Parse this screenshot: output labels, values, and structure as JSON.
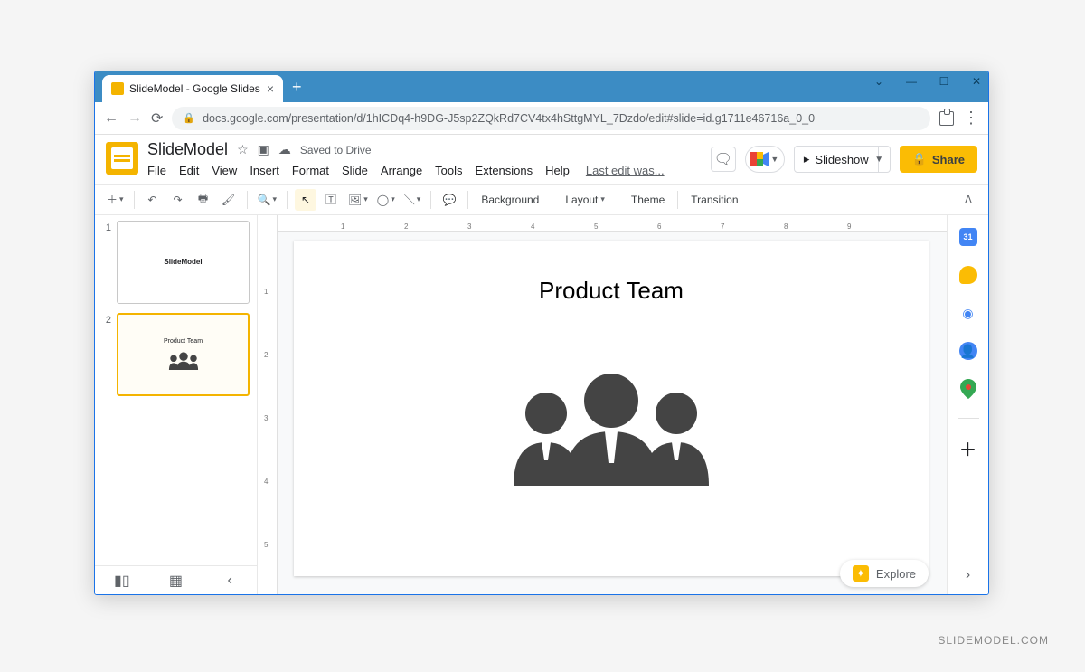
{
  "browser": {
    "tab_title": "SlideModel - Google Slides",
    "url": "docs.google.com/presentation/d/1hICDq4-h9DG-J5sp2ZQkRd7CV4tx4hSttgMYL_7Dzdo/edit#slide=id.g1711e46716a_0_0"
  },
  "header": {
    "doc_title": "SlideModel",
    "saved_status": "Saved to Drive",
    "last_edit": "Last edit was...",
    "menu": [
      "File",
      "Edit",
      "View",
      "Insert",
      "Format",
      "Slide",
      "Arrange",
      "Tools",
      "Extensions",
      "Help"
    ],
    "slideshow_label": "Slideshow",
    "share_label": "Share"
  },
  "toolbar": {
    "background": "Background",
    "layout": "Layout",
    "theme": "Theme",
    "transition": "Transition"
  },
  "slides": [
    {
      "number": "1",
      "title": "SlideModel"
    },
    {
      "number": "2",
      "title": "Product Team"
    }
  ],
  "canvas": {
    "title": "Product Team",
    "ruler_h": [
      "1",
      "2",
      "3",
      "4",
      "5",
      "6",
      "7",
      "8",
      "9"
    ],
    "ruler_v": [
      "1",
      "2",
      "3",
      "4",
      "5"
    ]
  },
  "explore": {
    "label": "Explore"
  },
  "watermark": "SLIDEMODEL.COM"
}
